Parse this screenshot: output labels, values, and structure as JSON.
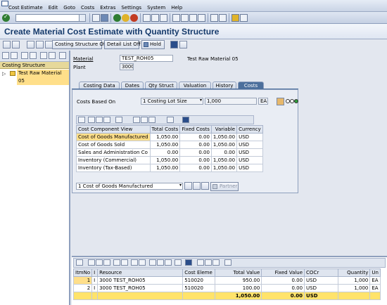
{
  "menubar": {
    "items": [
      "Cost Estimate",
      "Edit",
      "Goto",
      "Costs",
      "Extras",
      "Settings",
      "System",
      "Help"
    ]
  },
  "title": "Create Material Cost Estimate with Quantity Structure",
  "app_toolbar": {
    "costing_structure_off": "Costing Structure Off",
    "detail_list_off": "Detail List Off",
    "hold": "Hold"
  },
  "tree": {
    "header": "Costing Structure",
    "node": "Test Raw Material 05"
  },
  "header_fields": {
    "material_label": "Material",
    "material_value": "TEST_ROH05",
    "material_desc": "Test Raw Material 05",
    "plant_label": "Plant",
    "plant_value": "3000"
  },
  "tabs": [
    {
      "label": "Costing Data",
      "active": false
    },
    {
      "label": "Dates",
      "active": false
    },
    {
      "label": "Qty Struct",
      "active": false
    },
    {
      "label": "Valuation",
      "active": false
    },
    {
      "label": "History",
      "active": false
    },
    {
      "label": "Costs",
      "active": true
    }
  ],
  "costs_tab": {
    "costs_based_on_label": "Costs Based On",
    "costs_based_on_value": "1 Costing Lot Size",
    "lot_size": "1,000",
    "unit": "EA",
    "columns": [
      "Cost Component View",
      "Total Costs",
      "Fixed Costs",
      "Variable",
      "Currency"
    ],
    "rows": [
      [
        "Cost of Goods Manufactured",
        "1,050.00",
        "0.00",
        "1,050.00",
        "USD"
      ],
      [
        "Cost of Goods Sold",
        "1,050.00",
        "0.00",
        "1,050.00",
        "USD"
      ],
      [
        "Sales and Administration Co",
        "0.00",
        "0.00",
        "0.00",
        "USD"
      ],
      [
        "Inventory (Commercial)",
        "1,050.00",
        "0.00",
        "1,050.00",
        "USD"
      ],
      [
        "Inventory (Tax-Based)",
        "1,050.00",
        "0.00",
        "1,050.00",
        "USD"
      ]
    ],
    "view_select": "1 Cost of Goods Manufactured",
    "partner_button": "Partner"
  },
  "items": {
    "columns": [
      "ItmNo",
      "I",
      "Resource",
      "Cost Eleme",
      "Total Value",
      "Fixed Value",
      "COCr",
      "Quantity",
      "Un"
    ],
    "rows": [
      [
        "1",
        "I",
        "3000 TEST_ROH05",
        "510020",
        "950.00",
        "0.00",
        "USD",
        "1,000",
        "EA"
      ],
      [
        "2",
        "I",
        "3000 TEST_ROH05",
        "510020",
        "100.00",
        "0.00",
        "USD",
        "1,000",
        "EA"
      ]
    ],
    "total": {
      "total_value": "1,050.00",
      "fixed_value": "0.00",
      "currency": "USD"
    }
  }
}
